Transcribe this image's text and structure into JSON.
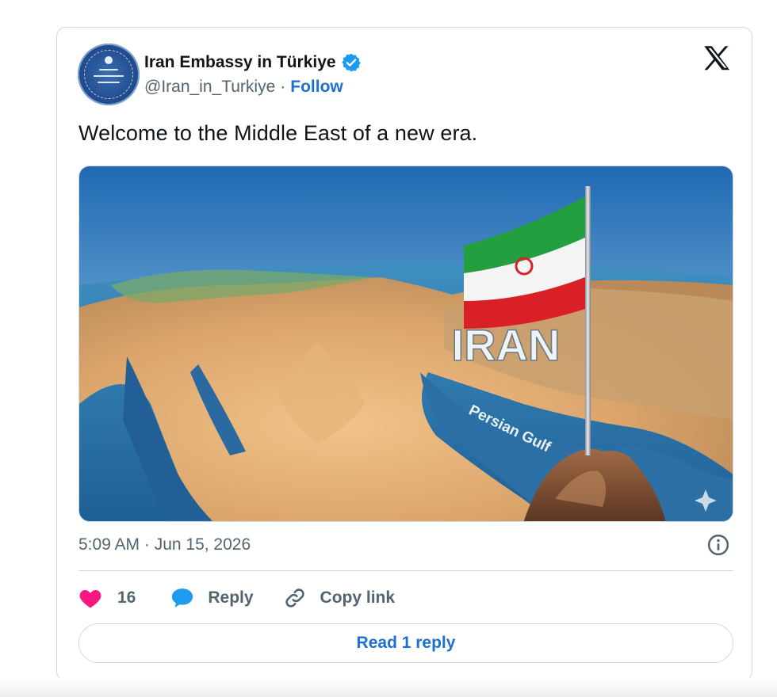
{
  "tweet": {
    "display_name": "Iran Embassy in Türkiye",
    "handle": "@Iran_in_Turkiye",
    "separator": "·",
    "follow_label": "Follow",
    "text": "Welcome to the Middle East of a new era.",
    "timestamp": "5:09 AM · Jun 15, 2026"
  },
  "media": {
    "overlay_title": "IRAN",
    "overlay_label": "Persian Gulf"
  },
  "actions": {
    "like_count": "16",
    "reply_label": "Reply",
    "copy_link_label": "Copy link"
  },
  "footer": {
    "read_replies_label": "Read 1 reply"
  },
  "icons": {
    "verified": "verified-badge-icon",
    "platform": "x-logo-icon",
    "info": "info-icon",
    "like": "heart-icon",
    "reply": "speech-bubble-icon",
    "copy": "link-icon"
  },
  "colors": {
    "accent_blue": "#1d6fd1",
    "verified_blue": "#1d9bf0",
    "like_pink": "#f91880",
    "text_primary": "#0f1419",
    "text_secondary": "#536471",
    "border": "#cfd9de"
  }
}
